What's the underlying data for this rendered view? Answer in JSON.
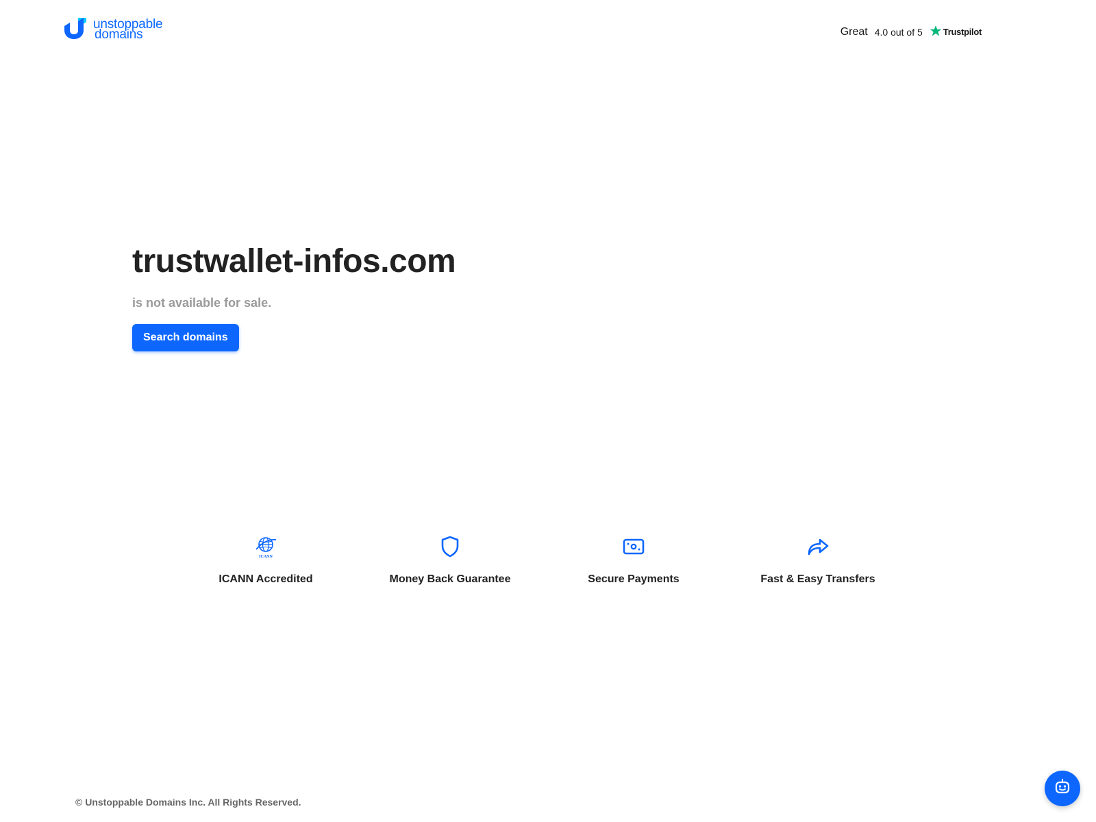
{
  "header": {
    "logo": {
      "line1": "unstoppable",
      "line2": "domains",
      "icon": "unstoppable-domains-logo-icon"
    },
    "trustpilot": {
      "rating_word": "Great",
      "score_text": "4.0 out of 5",
      "brand": "Trustpilot",
      "icon": "trustpilot-star-icon"
    }
  },
  "hero": {
    "domain": "trustwallet-infos.com",
    "subtitle": "is not available for sale.",
    "button_label": "Search domains"
  },
  "features": [
    {
      "label": "ICANN Accredited",
      "icon": "icann-globe-icon"
    },
    {
      "label": "Money Back Guarantee",
      "icon": "shield-icon"
    },
    {
      "label": "Secure Payments",
      "icon": "payment-card-icon"
    },
    {
      "label": "Fast & Easy Transfers",
      "icon": "share-arrow-icon"
    }
  ],
  "footer": {
    "copyright": "© Unstoppable Domains Inc. All Rights Reserved."
  },
  "chat": {
    "icon": "chat-robot-icon"
  },
  "colors": {
    "brand_blue": "#0d67fe",
    "trustpilot_green": "#00b67a",
    "text_dark": "#222222",
    "text_muted": "#9a9a9a"
  }
}
